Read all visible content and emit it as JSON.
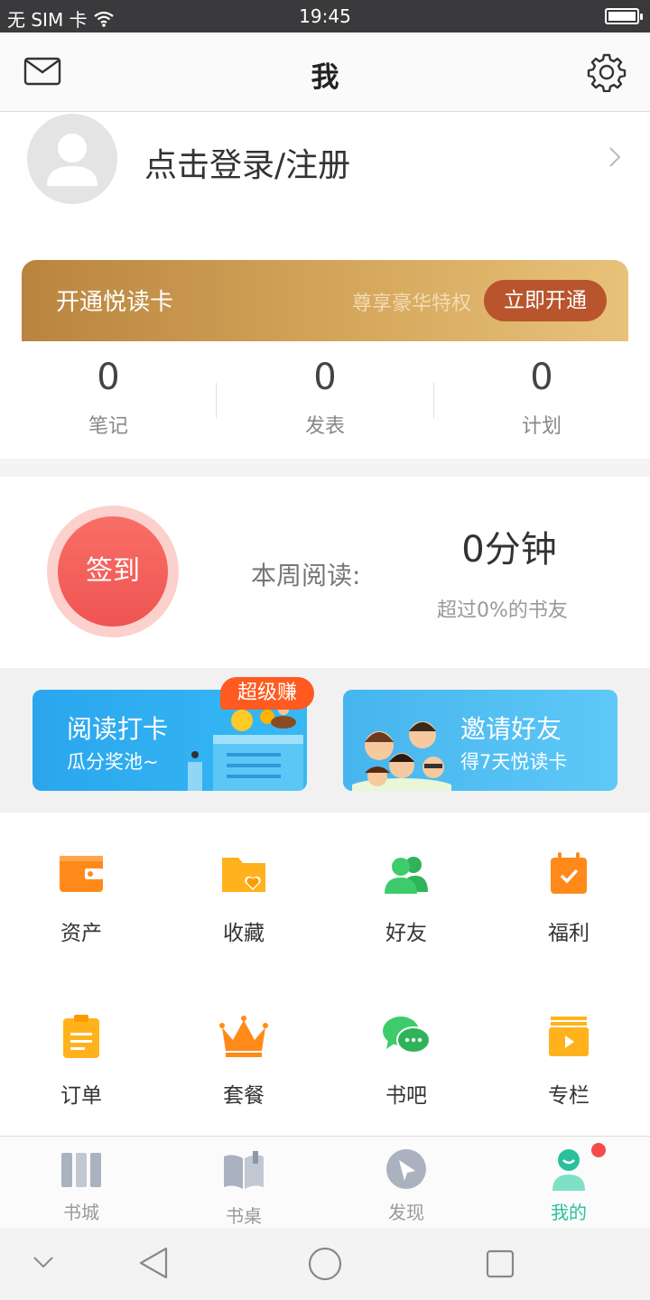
{
  "status": {
    "carrier": "无 SIM 卡",
    "time": "19:45"
  },
  "header": {
    "title": "我"
  },
  "profile": {
    "login_label": "点击登录/注册"
  },
  "vip": {
    "title": "开通悦读卡",
    "subtitle": "尊享豪华特权",
    "button": "立即开通"
  },
  "stats": [
    {
      "value": "0",
      "label": "笔记"
    },
    {
      "value": "0",
      "label": "发表"
    },
    {
      "value": "0",
      "label": "计划"
    }
  ],
  "checkin": {
    "button": "签到",
    "week_label": "本周阅读:",
    "minutes": "0分钟",
    "beat": "超过0%的书友"
  },
  "banners": [
    {
      "title": "阅读打卡",
      "subtitle": "瓜分奖池~",
      "badge": "超级赚",
      "accent": "#2ba6ee"
    },
    {
      "title": "邀请好友",
      "subtitle": "得7天悦读卡",
      "accent": "#46b5ee"
    }
  ],
  "menu": [
    {
      "label": "资产",
      "icon": "wallet-icon",
      "color": "#ff8a1a"
    },
    {
      "label": "收藏",
      "icon": "folder-heart-icon",
      "color": "#ffb21c"
    },
    {
      "label": "好友",
      "icon": "friends-icon",
      "color": "#3ecb6b"
    },
    {
      "label": "福利",
      "icon": "calendar-check-icon",
      "color": "#ff8a1a"
    },
    {
      "label": "订单",
      "icon": "clipboard-icon",
      "color": "#ffb21c"
    },
    {
      "label": "套餐",
      "icon": "crown-icon",
      "color": "#ff8a1a"
    },
    {
      "label": "书吧",
      "icon": "chat-bubbles-icon",
      "color": "#3ecb6b"
    },
    {
      "label": "专栏",
      "icon": "video-column-icon",
      "color": "#ffb21c"
    }
  ],
  "tabs": [
    {
      "label": "书城",
      "icon": "bookshelf-icon"
    },
    {
      "label": "书桌",
      "icon": "open-book-icon"
    },
    {
      "label": "发现",
      "icon": "compass-icon"
    },
    {
      "label": "我的",
      "icon": "user-icon",
      "active": true,
      "accent": "#2bbf9c"
    }
  ]
}
